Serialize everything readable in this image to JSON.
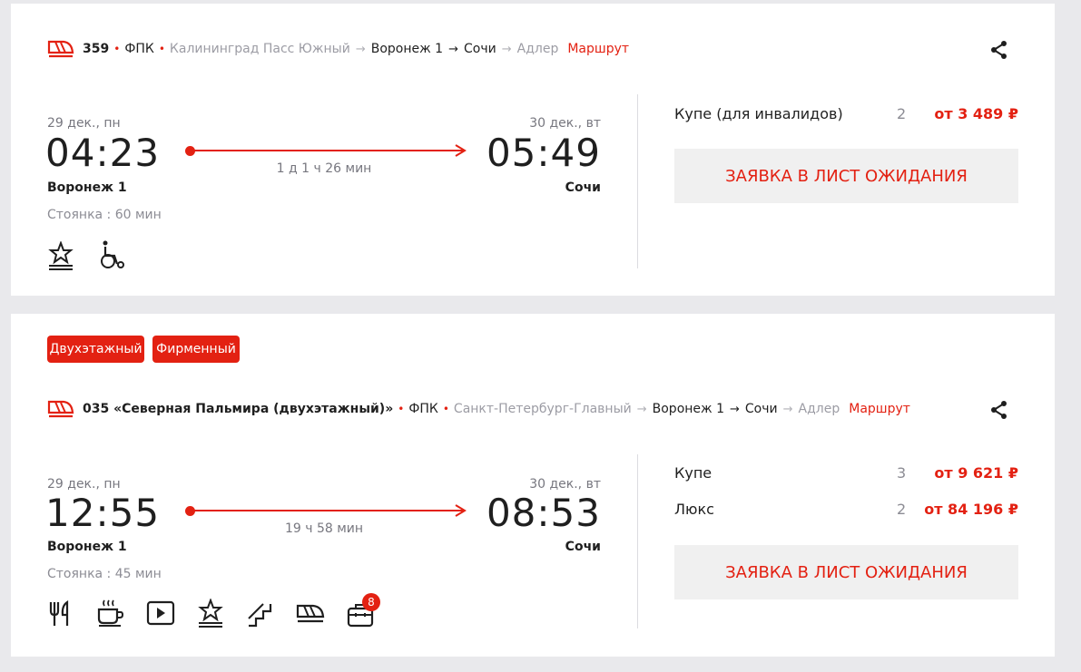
{
  "trains": [
    {
      "number": "359",
      "carrier": "ФПК",
      "route": {
        "origin": "Калининград Пасс Южный",
        "from": "Воронеж 1",
        "to": "Сочи",
        "final": "Адлер",
        "link_label": "Маршрут"
      },
      "departure": {
        "date": "29 дек., пн",
        "time": "04:23",
        "station": "Воронеж 1"
      },
      "arrival": {
        "date": "30 дек., вт",
        "time": "05:49",
        "station": "Сочи"
      },
      "duration": "1 д 1 ч 26 мин",
      "stop": "Стоянка : 60 мин",
      "amenities": [
        "star-podium-icon",
        "wheelchair-icon"
      ],
      "classes": [
        {
          "name": "Купе (для инвалидов)",
          "seats": "2",
          "price": "от 3 489 ₽"
        }
      ],
      "wait_button": "ЗАЯВКА В ЛИСТ ОЖИДАНИЯ"
    },
    {
      "badges": [
        "Двухэтажный",
        "Фирменный"
      ],
      "number": "035 «Северная Пальмира (двухэтажный)»",
      "carrier": "ФПК",
      "route": {
        "origin": "Санкт-Петербург-Главный",
        "from": "Воронеж 1",
        "to": "Сочи",
        "final": "Адлер",
        "link_label": "Маршрут"
      },
      "departure": {
        "date": "29 дек., пн",
        "time": "12:55",
        "station": "Воронеж 1"
      },
      "arrival": {
        "date": "30 дек., вт",
        "time": "08:53",
        "station": "Сочи"
      },
      "duration": "19 ч 58 мин",
      "stop": "Стоянка : 45 мин",
      "amenities": [
        "restaurant-icon",
        "coffee-icon",
        "video-icon",
        "star-podium-icon",
        "stairs-icon",
        "train-icon",
        "luggage-icon"
      ],
      "amenity_count_badge": "8",
      "classes": [
        {
          "name": "Купе",
          "seats": "3",
          "price": "от 9 621 ₽"
        },
        {
          "name": "Люкс",
          "seats": "2",
          "price": "от 84 196 ₽"
        }
      ],
      "wait_button": "ЗАЯВКА В ЛИСТ ОЖИДАНИЯ"
    }
  ],
  "colors": {
    "accent": "#e32112",
    "background": "#e9e9ec",
    "card": "#ffffff",
    "button_bg": "#f0f0f0"
  }
}
